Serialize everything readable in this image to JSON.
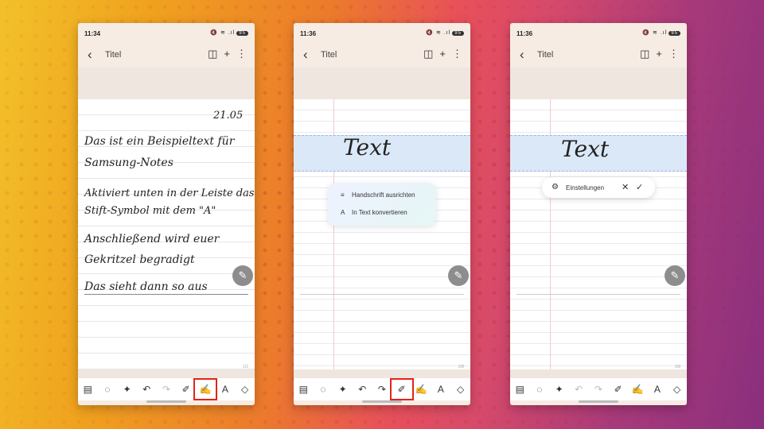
{
  "phones": [
    {
      "time": "11:34",
      "status_icons": "🔇 ≋ .ıl",
      "battery": "95",
      "title": "Titel",
      "page": "1/2"
    },
    {
      "time": "11:36",
      "status_icons": "🔇 ≋ .ıl",
      "battery": "95",
      "title": "Titel",
      "page": "2/8"
    },
    {
      "time": "11:36",
      "status_icons": "🔇 ≋ .ıl",
      "battery": "95",
      "title": "Titel",
      "page": "2/8"
    }
  ],
  "note": {
    "date": "21.05",
    "lines": [
      "Das ist ein Beispieltext für",
      "Samsung-Notes",
      "Aktiviert unten in der Leiste das",
      "Stift-Symbol mit dem \"A\"",
      "Anschließend wird euer",
      "Gekritzel begradigt",
      "Das sieht dann so aus"
    ]
  },
  "handwriting_word": "Text",
  "menu": {
    "item1": "Handschrift ausrichten",
    "item2": "In Text konvertieren"
  },
  "pill": {
    "label": "Einstellungen"
  },
  "icons": {
    "back": "‹",
    "split": "◫",
    "add": "+",
    "more": "⋮",
    "pen": "✎",
    "tools": [
      "▤",
      "◌",
      "✦",
      "↶",
      "↷",
      "✐",
      "✍",
      "A",
      "◇"
    ],
    "menu_icon1": "≡",
    "menu_icon2": "A",
    "gear": "⚙",
    "close": "✕",
    "check": "✓"
  },
  "colors": {
    "highlight": "#e1241b",
    "selection": "#dbe8f7"
  }
}
